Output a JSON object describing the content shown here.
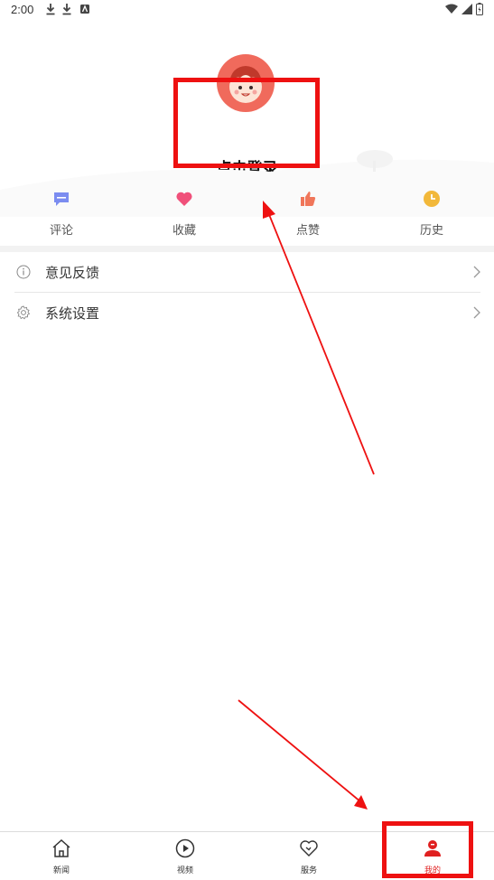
{
  "status_bar": {
    "time": "2:00",
    "left_icons": [
      "download-icon",
      "download-icon",
      "app-icon"
    ],
    "right_icons": [
      "wifi-icon",
      "signal-icon",
      "battery-icon"
    ]
  },
  "profile": {
    "avatar_icon": "avatar-icon",
    "login_label": "点击登录"
  },
  "actions": [
    {
      "label": "评论",
      "icon": "comment-icon",
      "color": "#7b8cf0"
    },
    {
      "label": "收藏",
      "icon": "heart-icon",
      "color": "#f0507a"
    },
    {
      "label": "点赞",
      "icon": "thumbs-up-icon",
      "color": "#f0765a"
    },
    {
      "label": "历史",
      "icon": "clock-icon",
      "color": "#f2b83a"
    }
  ],
  "list": [
    {
      "label": "意见反馈",
      "icon": "info-icon"
    },
    {
      "label": "系统设置",
      "icon": "gear-icon"
    }
  ],
  "bottom_nav": [
    {
      "label": "新闻",
      "icon": "home-icon"
    },
    {
      "label": "视频",
      "icon": "play-icon"
    },
    {
      "label": "服务",
      "icon": "heart-outline-icon"
    },
    {
      "label": "我的",
      "icon": "user-icon",
      "active": true
    }
  ],
  "colors": {
    "accent": "#e02020",
    "annotation": "#ee1111"
  }
}
